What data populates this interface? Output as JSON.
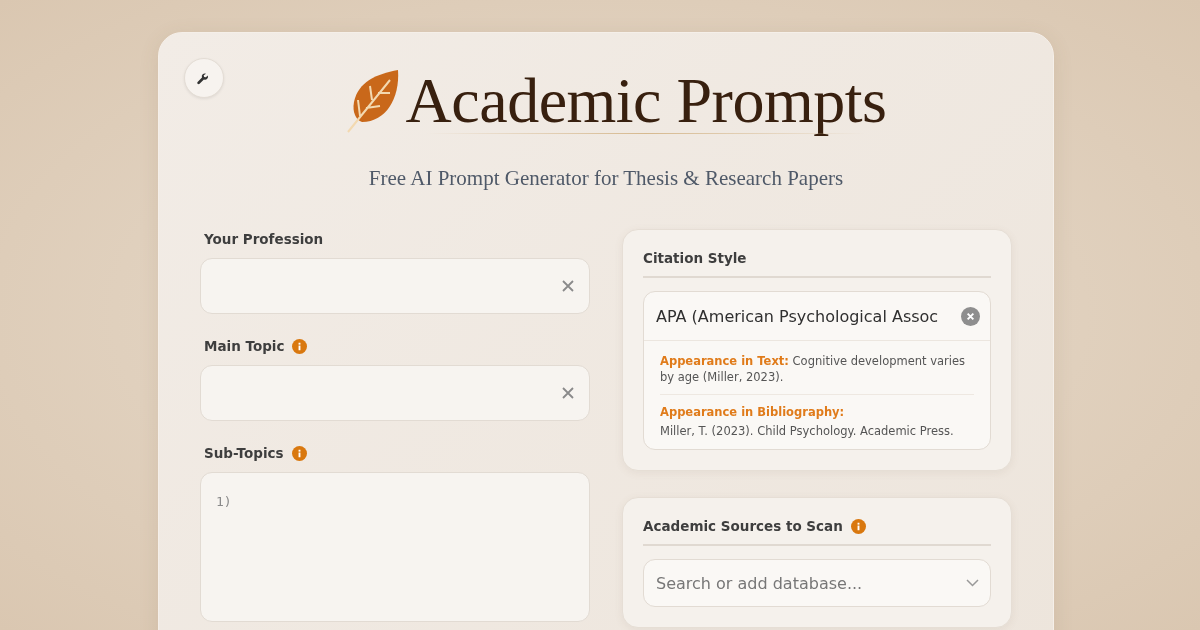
{
  "header": {
    "title": "Academic Prompts",
    "subtitle": "Free AI Prompt Generator for Thesis & Research Papers"
  },
  "fields": [
    {
      "label": "Your Profession",
      "info": false,
      "kind": "input",
      "clearable": true
    },
    {
      "label": "Main Topic",
      "info": true,
      "kind": "input",
      "clearable": true
    },
    {
      "label": "Sub-Topics",
      "info": true,
      "kind": "textarea",
      "value": "1)"
    }
  ],
  "citation": {
    "label": "Citation Style",
    "value": "APA (American Psychological Assoc",
    "clearable": true,
    "examples": [
      {
        "kind": "inline",
        "text": "**Appearance in Text:** Cognitive development varies by age (Miller, 2023)."
      },
      {
        "kind": "block",
        "label": "Appearance in Bibliography:",
        "text": "Miller, T. (2023). Child Psychology. Academic Press."
      }
    ]
  },
  "sources": {
    "label": "Academic Sources to Scan",
    "info": true,
    "placeholder": "Search or add database..."
  }
}
